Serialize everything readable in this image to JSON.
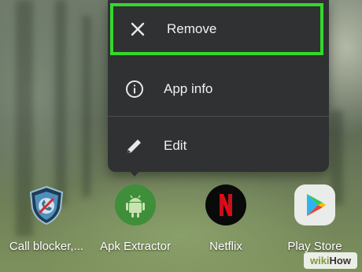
{
  "context_menu": {
    "items": [
      {
        "label": "Remove",
        "icon": "close-icon"
      },
      {
        "label": "App info",
        "icon": "info-icon"
      },
      {
        "label": "Edit",
        "icon": "pencil-icon"
      }
    ],
    "highlight_color": "#35d82b",
    "background": "#303132"
  },
  "apps": [
    {
      "label": "Call blocker,...",
      "icon": "call-blocker-shield-icon"
    },
    {
      "label": "Apk Extractor",
      "icon": "android-robot-icon"
    },
    {
      "label": "Netflix",
      "icon": "netflix-n-icon"
    },
    {
      "label": "Play Store",
      "icon": "play-store-icon"
    }
  ],
  "watermark": {
    "part1": "wiki",
    "part2": "How"
  }
}
